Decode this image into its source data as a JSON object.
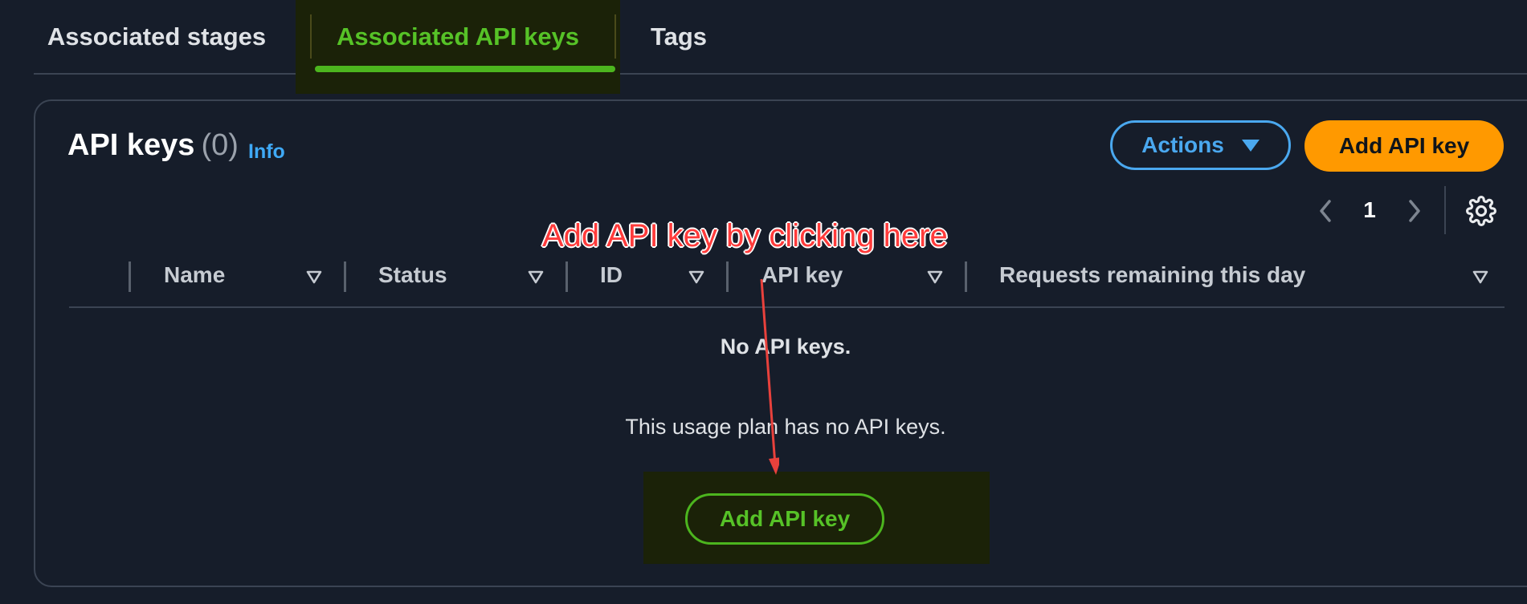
{
  "tabs": [
    {
      "label": "Associated stages",
      "active": false
    },
    {
      "label": "Associated API keys",
      "active": true
    },
    {
      "label": "Tags",
      "active": false
    }
  ],
  "panel": {
    "title": "API keys",
    "count": "(0)",
    "info_label": "Info",
    "actions_label": "Actions",
    "add_button_label": "Add API key"
  },
  "pagination": {
    "current_page": "1"
  },
  "table": {
    "columns": [
      "Name",
      "Status",
      "ID",
      "API key",
      "Requests remaining this day"
    ],
    "rows": []
  },
  "empty_state": {
    "title": "No API keys.",
    "description": "This usage plan has no API keys.",
    "button_label": "Add API key"
  },
  "annotation": {
    "text": "Add API key by clicking here",
    "color": "#ff3b3b"
  },
  "colors": {
    "background": "#161d2a",
    "active_tab": "#56c227",
    "primary_button": "#ff9900",
    "link": "#3fa9f5"
  }
}
